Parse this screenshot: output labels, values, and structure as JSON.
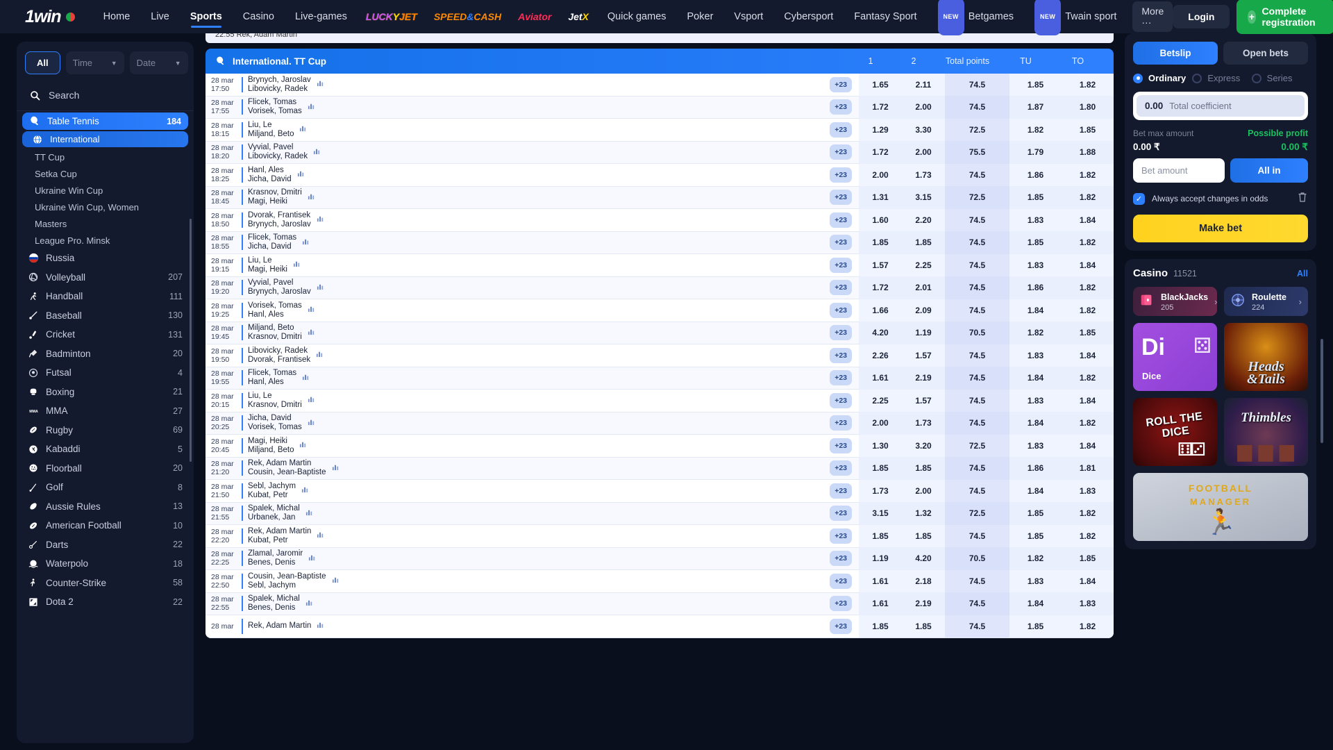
{
  "topnav": {
    "logo": "1win",
    "items": [
      {
        "label": "Home",
        "type": "text",
        "active": false
      },
      {
        "label": "Live",
        "type": "text",
        "active": false
      },
      {
        "label": "Sports",
        "type": "text",
        "active": true
      },
      {
        "label": "Casino",
        "type": "text",
        "active": false
      },
      {
        "label": "Live-games",
        "type": "text",
        "active": false
      },
      {
        "label": "LUCKYJET",
        "type": "brand-lucky",
        "active": false
      },
      {
        "label": "SPEED&CASH",
        "type": "brand-speed",
        "active": false
      },
      {
        "label": "Aviator",
        "type": "brand-aviator",
        "active": false
      },
      {
        "label": "JetX",
        "type": "brand-jetx",
        "active": false
      },
      {
        "label": "Quick games",
        "type": "text",
        "active": false
      },
      {
        "label": "Poker",
        "type": "text",
        "active": false
      },
      {
        "label": "Vsport",
        "type": "text",
        "active": false
      },
      {
        "label": "Cybersport",
        "type": "text",
        "active": false
      },
      {
        "label": "Fantasy Sport",
        "type": "text",
        "active": false
      },
      {
        "label": "Betgames",
        "type": "text",
        "badge": "NEW",
        "active": false
      },
      {
        "label": "Twain sport",
        "type": "text",
        "badge": "NEW",
        "active": false
      }
    ],
    "more_label": "More",
    "login_label": "Login",
    "register_label": "Complete registration",
    "accent_blue": "#2f80ff",
    "accent_green": "#17a84a"
  },
  "sidebar": {
    "filter_all": "All",
    "filter_time": "Time",
    "filter_date": "Date",
    "search_label": "Search",
    "items": [
      {
        "label": "Table Tennis",
        "count": "184",
        "kind": "selected",
        "icon": "table-tennis-icon"
      },
      {
        "label": "International",
        "count": "",
        "kind": "sub",
        "icon": "globe-icon"
      },
      {
        "label": "TT Cup",
        "count": "",
        "kind": "leaf",
        "icon": ""
      },
      {
        "label": "Setka Cup",
        "count": "",
        "kind": "leaf",
        "icon": ""
      },
      {
        "label": "Ukraine Win Cup",
        "count": "",
        "kind": "leaf",
        "icon": ""
      },
      {
        "label": "Ukraine Win Cup, Women",
        "count": "",
        "kind": "leaf",
        "icon": ""
      },
      {
        "label": "Masters",
        "count": "",
        "kind": "leaf",
        "icon": ""
      },
      {
        "label": "League Pro. Minsk",
        "count": "",
        "kind": "leaf",
        "icon": ""
      },
      {
        "label": "Russia",
        "count": "",
        "kind": "country",
        "icon": "flag-russia-icon"
      },
      {
        "label": "Volleyball",
        "count": "207",
        "kind": "sport",
        "icon": "volleyball-icon"
      },
      {
        "label": "Handball",
        "count": "111",
        "kind": "sport",
        "icon": "handball-icon"
      },
      {
        "label": "Baseball",
        "count": "130",
        "kind": "sport",
        "icon": "baseball-icon"
      },
      {
        "label": "Cricket",
        "count": "131",
        "kind": "sport",
        "icon": "cricket-icon"
      },
      {
        "label": "Badminton",
        "count": "20",
        "kind": "sport",
        "icon": "badminton-icon"
      },
      {
        "label": "Futsal",
        "count": "4",
        "kind": "sport",
        "icon": "futsal-icon"
      },
      {
        "label": "Boxing",
        "count": "21",
        "kind": "sport",
        "icon": "boxing-icon"
      },
      {
        "label": "MMA",
        "count": "27",
        "kind": "sport",
        "icon": "mma-icon"
      },
      {
        "label": "Rugby",
        "count": "69",
        "kind": "sport",
        "icon": "rugby-icon"
      },
      {
        "label": "Kabaddi",
        "count": "5",
        "kind": "sport",
        "icon": "kabaddi-icon"
      },
      {
        "label": "Floorball",
        "count": "20",
        "kind": "sport",
        "icon": "floorball-icon"
      },
      {
        "label": "Golf",
        "count": "8",
        "kind": "sport",
        "icon": "golf-icon"
      },
      {
        "label": "Aussie Rules",
        "count": "13",
        "kind": "sport",
        "icon": "aussie-rules-icon"
      },
      {
        "label": "American Football",
        "count": "10",
        "kind": "sport",
        "icon": "american-football-icon"
      },
      {
        "label": "Darts",
        "count": "22",
        "kind": "sport",
        "icon": "darts-icon"
      },
      {
        "label": "Waterpolo",
        "count": "18",
        "kind": "sport",
        "icon": "waterpolo-icon"
      },
      {
        "label": "Counter-Strike",
        "count": "58",
        "kind": "sport",
        "icon": "counter-strike-icon"
      },
      {
        "label": "Dota 2",
        "count": "22",
        "kind": "sport",
        "icon": "dota2-icon"
      }
    ]
  },
  "main": {
    "cut_row_text": "22:55   Rek, Adam Martin",
    "league_title": "International.  TT Cup",
    "columns": [
      "1",
      "2",
      "Total points",
      "TU",
      "TO"
    ],
    "plus_label": "+23",
    "rows": [
      {
        "date": "28 mar",
        "time": "17:50",
        "p1": "Brynych, Jaroslav",
        "p2": "Libovicky, Radek",
        "o1": "1.65",
        "o2": "2.11",
        "tp": "74.5",
        "tu": "1.85",
        "to": "1.82"
      },
      {
        "date": "28 mar",
        "time": "17:55",
        "p1": "Flicek, Tomas",
        "p2": "Vorisek, Tomas",
        "o1": "1.72",
        "o2": "2.00",
        "tp": "74.5",
        "tu": "1.87",
        "to": "1.80"
      },
      {
        "date": "28 mar",
        "time": "18:15",
        "p1": "Liu, Le",
        "p2": "Miljand, Beto",
        "o1": "1.29",
        "o2": "3.30",
        "tp": "72.5",
        "tu": "1.82",
        "to": "1.85"
      },
      {
        "date": "28 mar",
        "time": "18:20",
        "p1": "Vyvial, Pavel",
        "p2": "Libovicky, Radek",
        "o1": "1.72",
        "o2": "2.00",
        "tp": "75.5",
        "tu": "1.79",
        "to": "1.88"
      },
      {
        "date": "28 mar",
        "time": "18:25",
        "p1": "Hanl, Ales",
        "p2": "Jicha, David",
        "o1": "2.00",
        "o2": "1.73",
        "tp": "74.5",
        "tu": "1.86",
        "to": "1.82"
      },
      {
        "date": "28 mar",
        "time": "18:45",
        "p1": "Krasnov, Dmitri",
        "p2": "Magi, Heiki",
        "o1": "1.31",
        "o2": "3.15",
        "tp": "72.5",
        "tu": "1.85",
        "to": "1.82"
      },
      {
        "date": "28 mar",
        "time": "18:50",
        "p1": "Dvorak, Frantisek",
        "p2": "Brynych, Jaroslav",
        "o1": "1.60",
        "o2": "2.20",
        "tp": "74.5",
        "tu": "1.83",
        "to": "1.84"
      },
      {
        "date": "28 mar",
        "time": "18:55",
        "p1": "Flicek, Tomas",
        "p2": "Jicha, David",
        "o1": "1.85",
        "o2": "1.85",
        "tp": "74.5",
        "tu": "1.85",
        "to": "1.82"
      },
      {
        "date": "28 mar",
        "time": "19:15",
        "p1": "Liu, Le",
        "p2": "Magi, Heiki",
        "o1": "1.57",
        "o2": "2.25",
        "tp": "74.5",
        "tu": "1.83",
        "to": "1.84"
      },
      {
        "date": "28 mar",
        "time": "19:20",
        "p1": "Vyvial, Pavel",
        "p2": "Brynych, Jaroslav",
        "o1": "1.72",
        "o2": "2.01",
        "tp": "74.5",
        "tu": "1.86",
        "to": "1.82"
      },
      {
        "date": "28 mar",
        "time": "19:25",
        "p1": "Vorisek, Tomas",
        "p2": "Hanl, Ales",
        "o1": "1.66",
        "o2": "2.09",
        "tp": "74.5",
        "tu": "1.84",
        "to": "1.82"
      },
      {
        "date": "28 mar",
        "time": "19:45",
        "p1": "Miljand, Beto",
        "p2": "Krasnov, Dmitri",
        "o1": "4.20",
        "o2": "1.19",
        "tp": "70.5",
        "tu": "1.82",
        "to": "1.85"
      },
      {
        "date": "28 mar",
        "time": "19:50",
        "p1": "Libovicky, Radek",
        "p2": "Dvorak, Frantisek",
        "o1": "2.26",
        "o2": "1.57",
        "tp": "74.5",
        "tu": "1.83",
        "to": "1.84"
      },
      {
        "date": "28 mar",
        "time": "19:55",
        "p1": "Flicek, Tomas",
        "p2": "Hanl, Ales",
        "o1": "1.61",
        "o2": "2.19",
        "tp": "74.5",
        "tu": "1.84",
        "to": "1.82"
      },
      {
        "date": "28 mar",
        "time": "20:15",
        "p1": "Liu, Le",
        "p2": "Krasnov, Dmitri",
        "o1": "2.25",
        "o2": "1.57",
        "tp": "74.5",
        "tu": "1.83",
        "to": "1.84"
      },
      {
        "date": "28 mar",
        "time": "20:25",
        "p1": "Jicha, David",
        "p2": "Vorisek, Tomas",
        "o1": "2.00",
        "o2": "1.73",
        "tp": "74.5",
        "tu": "1.84",
        "to": "1.82"
      },
      {
        "date": "28 mar",
        "time": "20:45",
        "p1": "Magi, Heiki",
        "p2": "Miljand, Beto",
        "o1": "1.30",
        "o2": "3.20",
        "tp": "72.5",
        "tu": "1.83",
        "to": "1.84"
      },
      {
        "date": "28 mar",
        "time": "21:20",
        "p1": "Rek, Adam Martin",
        "p2": "Cousin, Jean-Baptiste",
        "o1": "1.85",
        "o2": "1.85",
        "tp": "74.5",
        "tu": "1.86",
        "to": "1.81"
      },
      {
        "date": "28 mar",
        "time": "21:50",
        "p1": "Sebl, Jachym",
        "p2": "Kubat, Petr",
        "o1": "1.73",
        "o2": "2.00",
        "tp": "74.5",
        "tu": "1.84",
        "to": "1.83"
      },
      {
        "date": "28 mar",
        "time": "21:55",
        "p1": "Spalek, Michal",
        "p2": "Urbanek, Jan",
        "o1": "3.15",
        "o2": "1.32",
        "tp": "72.5",
        "tu": "1.85",
        "to": "1.82"
      },
      {
        "date": "28 mar",
        "time": "22:20",
        "p1": "Rek, Adam Martin",
        "p2": "Kubat, Petr",
        "o1": "1.85",
        "o2": "1.85",
        "tp": "74.5",
        "tu": "1.85",
        "to": "1.82"
      },
      {
        "date": "28 mar",
        "time": "22:25",
        "p1": "Zlamal, Jaromir",
        "p2": "Benes, Denis",
        "o1": "1.19",
        "o2": "4.20",
        "tp": "70.5",
        "tu": "1.82",
        "to": "1.85"
      },
      {
        "date": "28 mar",
        "time": "22:50",
        "p1": "Cousin, Jean-Baptiste",
        "p2": "Sebl, Jachym",
        "o1": "1.61",
        "o2": "2.18",
        "tp": "74.5",
        "tu": "1.83",
        "to": "1.84"
      },
      {
        "date": "28 mar",
        "time": "22:55",
        "p1": "Spalek, Michal",
        "p2": "Benes, Denis",
        "o1": "1.61",
        "o2": "2.19",
        "tp": "74.5",
        "tu": "1.84",
        "to": "1.83"
      },
      {
        "date": "28 mar",
        "time": "",
        "p1": "Rek, Adam Martin",
        "p2": "",
        "o1": "1.85",
        "o2": "1.85",
        "tp": "74.5",
        "tu": "1.85",
        "to": "1.82"
      }
    ]
  },
  "betslip": {
    "tab_betslip": "Betslip",
    "tab_openbets": "Open bets",
    "mode_ordinary": "Ordinary",
    "mode_express": "Express",
    "mode_series": "Series",
    "coefficient_value": "0.00",
    "coefficient_label": "Total coefficient",
    "bet_max_label": "Bet max amount",
    "bet_max_value": "0.00 ₹",
    "possible_profit_label": "Possible profit",
    "possible_profit_value": "0.00 ₹",
    "bet_amount_placeholder": "Bet amount",
    "all_in_label": "All in",
    "accept_changes_label": "Always accept changes in odds",
    "make_bet_label": "Make bet"
  },
  "casino": {
    "title": "Casino",
    "count": "11521",
    "all_label": "All",
    "tiles": [
      {
        "name": "BlackJacks",
        "count": "205",
        "kind": "bj"
      },
      {
        "name": "Roulette",
        "count": "224",
        "kind": "rl"
      }
    ],
    "games": [
      {
        "name": "Dice",
        "kind": "dice",
        "big": "Di"
      },
      {
        "name": "Heads & Tails",
        "kind": "heads",
        "line1": "Heads",
        "line2": "&Tails"
      },
      {
        "name": "Roll the Dice",
        "kind": "roll",
        "text": "ROLL THE DICE"
      },
      {
        "name": "Thimbles",
        "kind": "thimbles",
        "text": "Thimbles"
      },
      {
        "name": "Football Manager",
        "kind": "fm",
        "line1": "FOOTBALL",
        "line2": "MANAGER"
      }
    ]
  }
}
